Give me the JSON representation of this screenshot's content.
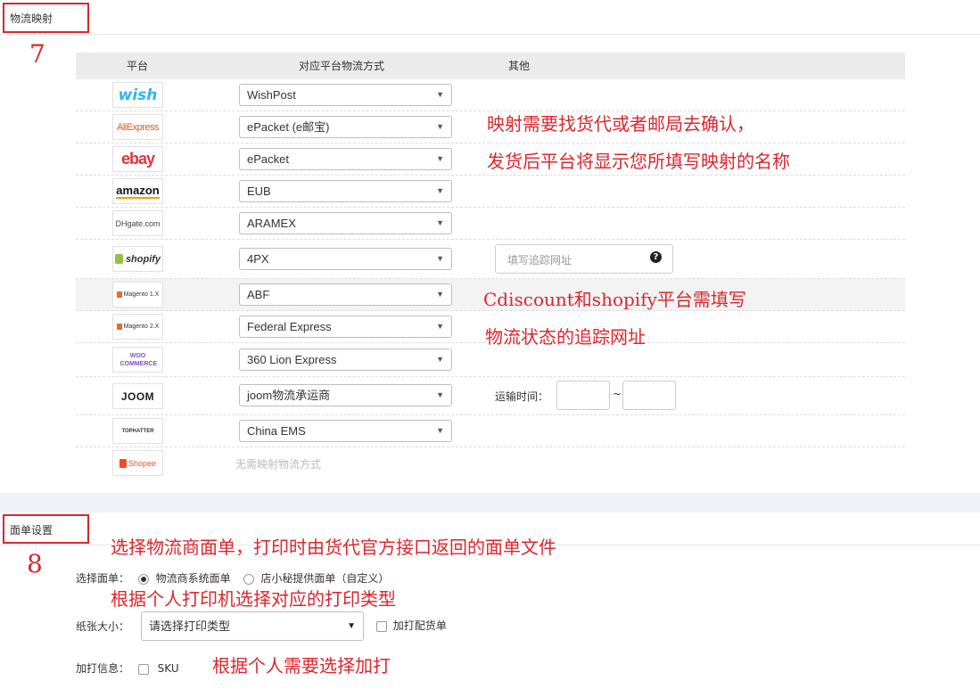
{
  "section1": {
    "tab_label": "物流映射",
    "number": "7",
    "columns": {
      "platform": "平台",
      "method": "对应平台物流方式",
      "other": "其他"
    },
    "rows": [
      {
        "platform": "wish",
        "logo_text": "wish",
        "method": "WishPost"
      },
      {
        "platform": "aliexpress",
        "logo_text": "AliExpress",
        "method": "ePacket (e邮宝)"
      },
      {
        "platform": "ebay",
        "logo_text": "ebay",
        "method": "ePacket"
      },
      {
        "platform": "amazon",
        "logo_text": "amazon",
        "method": "EUB"
      },
      {
        "platform": "dhgate",
        "logo_text": "DHgate.com",
        "method": "ARAMEX"
      },
      {
        "platform": "shopify",
        "logo_text": "shopify",
        "method": "4PX"
      },
      {
        "platform": "magento1",
        "logo_text": "Magento 1.X",
        "method": "ABF"
      },
      {
        "platform": "magento2",
        "logo_text": "Magento 2.X",
        "method": "Federal Express"
      },
      {
        "platform": "woocommerce",
        "logo_text": "WOO COMMERCE",
        "method": "360 Lion Express"
      },
      {
        "platform": "joom",
        "logo_text": "JOOM",
        "method": "joom物流承运商"
      },
      {
        "platform": "tophatter",
        "logo_text": "TOPHATTER",
        "method": "China EMS"
      },
      {
        "platform": "shopee",
        "logo_text": "Shopee",
        "method": ""
      }
    ],
    "shopee_note": "无需映射物流方式",
    "tracking_url_placeholder": "填写追踪网址",
    "transport_time_label": "运输时间：",
    "transport_sep": "~",
    "annotations": {
      "line1": "映射需要找货代或者邮局去确认，",
      "line2": "发货后平台将显示您所填写映射的名称",
      "line3": "Cdiscount和shopify平台需填写",
      "line4": "物流状态的追踪网址"
    }
  },
  "section2": {
    "tab_label": "面单设置",
    "number": "8",
    "label_select": "选择面单：",
    "radio_option1": "物流商系统面单",
    "radio_option2": "店小秘提供面单（自定义）",
    "paper_label": "纸张大小：",
    "paper_placeholder": "请选择打印类型",
    "add_packing_label": "加打配货单",
    "extra_print_label": "加打信息：",
    "sku_label": "SKU",
    "annotations": {
      "line1": "选择物流商面单，打印时由货代官方接口返回的面单文件",
      "line2": "根据个人打印机选择对应的打印类型",
      "line3": "根据个人需要选择加打"
    }
  },
  "colors": {
    "accent_red": "#d9272e",
    "header_gray": "#ebebeb"
  }
}
